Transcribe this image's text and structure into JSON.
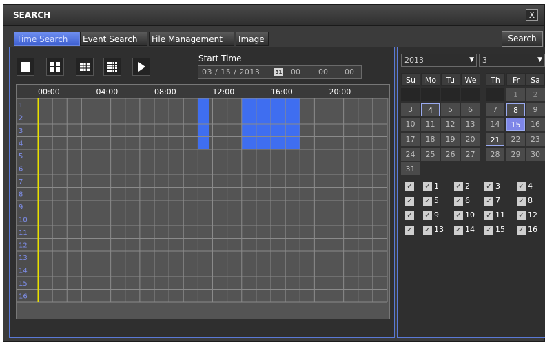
{
  "window": {
    "title": "SEARCH",
    "close_glyph": "X"
  },
  "tabs": [
    {
      "label": "Time Search",
      "active": true
    },
    {
      "label": "Event Search",
      "active": false
    },
    {
      "label": "File Management",
      "active": false
    },
    {
      "label": "Image",
      "active": false
    }
  ],
  "search_button": "Search",
  "layout_buttons": [
    {
      "name": "single-view-icon"
    },
    {
      "name": "quad-view-icon"
    },
    {
      "name": "nine-view-icon"
    },
    {
      "name": "sixteen-view-icon"
    },
    {
      "name": "play-icon"
    }
  ],
  "start_time": {
    "label": "Start Time",
    "date": "03 / 15 / 2013",
    "calendar_icon": "calendar-icon",
    "hour": "00",
    "minute": "00",
    "second": "00"
  },
  "timeline": {
    "time_labels": [
      "00:00",
      "04:00",
      "08:00",
      "12:00",
      "16:00",
      "20:00"
    ],
    "channels": [
      "1",
      "2",
      "3",
      "4",
      "5",
      "6",
      "7",
      "8",
      "9",
      "10",
      "11",
      "12",
      "13",
      "14",
      "15",
      "16"
    ],
    "recordings": [
      {
        "channel": 1,
        "start_hour": 11.0,
        "end_hour": 11.75
      },
      {
        "channel": 2,
        "start_hour": 11.0,
        "end_hour": 11.75
      },
      {
        "channel": 3,
        "start_hour": 11.0,
        "end_hour": 11.75
      },
      {
        "channel": 4,
        "start_hour": 11.0,
        "end_hour": 11.75
      },
      {
        "channel": 1,
        "start_hour": 14.0,
        "end_hour": 18.0
      },
      {
        "channel": 2,
        "start_hour": 14.0,
        "end_hour": 18.0
      },
      {
        "channel": 3,
        "start_hour": 14.0,
        "end_hour": 18.0
      },
      {
        "channel": 4,
        "start_hour": 14.0,
        "end_hour": 18.0
      }
    ],
    "colors": {
      "recording": "#3f6ef0",
      "cursor": "#e8e000",
      "grid": "#8a8a8a"
    }
  },
  "calendar": {
    "year": "2013",
    "month": "3",
    "weekdays": [
      "Su",
      "Mo",
      "Tu",
      "We",
      "Th",
      "Fr",
      "Sa"
    ],
    "first_weekday": 5,
    "days_in_month": 31,
    "record_days": [
      4,
      8,
      15,
      21
    ],
    "selected_day": 15
  },
  "channel_checks": [
    "",
    "1",
    "2",
    "3",
    "4",
    "",
    "5",
    "6",
    "7",
    "8",
    "",
    "9",
    "10",
    "11",
    "12",
    "",
    "13",
    "14",
    "15",
    "16"
  ]
}
